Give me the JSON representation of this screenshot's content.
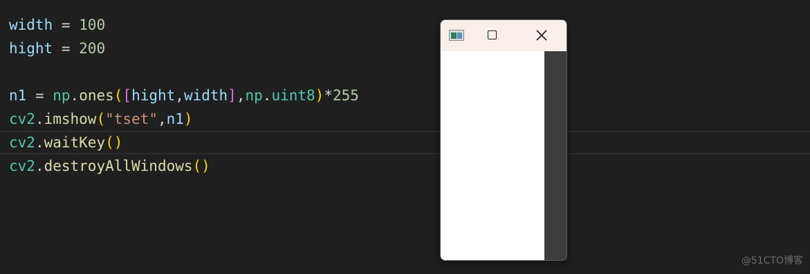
{
  "editor": {
    "lines": [
      {
        "tokens": [
          {
            "t": "width",
            "c": "var"
          },
          {
            "t": " = ",
            "c": "op"
          },
          {
            "t": "100",
            "c": "num"
          }
        ]
      },
      {
        "tokens": [
          {
            "t": "hight",
            "c": "var"
          },
          {
            "t": " = ",
            "c": "op"
          },
          {
            "t": "200",
            "c": "num"
          }
        ]
      },
      {
        "tokens": []
      },
      {
        "tokens": [
          {
            "t": "n1",
            "c": "var"
          },
          {
            "t": " = ",
            "c": "op"
          },
          {
            "t": "np",
            "c": "mod"
          },
          {
            "t": ".",
            "c": "punc"
          },
          {
            "t": "ones",
            "c": "fn"
          },
          {
            "t": "(",
            "c": "b1"
          },
          {
            "t": "[",
            "c": "b2"
          },
          {
            "t": "hight",
            "c": "var"
          },
          {
            "t": ",",
            "c": "punc"
          },
          {
            "t": "width",
            "c": "var"
          },
          {
            "t": "]",
            "c": "b2"
          },
          {
            "t": ",",
            "c": "punc"
          },
          {
            "t": "np",
            "c": "mod"
          },
          {
            "t": ".",
            "c": "punc"
          },
          {
            "t": "uint8",
            "c": "mod"
          },
          {
            "t": ")",
            "c": "b1"
          },
          {
            "t": "*",
            "c": "op"
          },
          {
            "t": "255",
            "c": "num"
          }
        ]
      },
      {
        "tokens": [
          {
            "t": "cv2",
            "c": "mod"
          },
          {
            "t": ".",
            "c": "punc"
          },
          {
            "t": "imshow",
            "c": "fn"
          },
          {
            "t": "(",
            "c": "b1"
          },
          {
            "t": "\"tset\"",
            "c": "str"
          },
          {
            "t": ",",
            "c": "punc"
          },
          {
            "t": "n1",
            "c": "var"
          },
          {
            "t": ")",
            "c": "b1"
          }
        ]
      },
      {
        "current": true,
        "tokens": [
          {
            "t": "cv2",
            "c": "mod"
          },
          {
            "t": ".",
            "c": "punc"
          },
          {
            "t": "waitKey",
            "c": "fn"
          },
          {
            "t": "()",
            "c": "b1"
          }
        ]
      },
      {
        "tokens": [
          {
            "t": "cv2",
            "c": "mod"
          },
          {
            "t": ".",
            "c": "punc"
          },
          {
            "t": "destroyAllWindows",
            "c": "fn"
          },
          {
            "t": "()",
            "c": "b1"
          }
        ]
      }
    ]
  },
  "window": {
    "icon": "opencv-app-icon",
    "controls": [
      "maximize-icon",
      "close-icon"
    ],
    "image_fill": "#ffffff",
    "titlebar_color": "#f8eeea"
  },
  "watermark": "@51CTO博客"
}
